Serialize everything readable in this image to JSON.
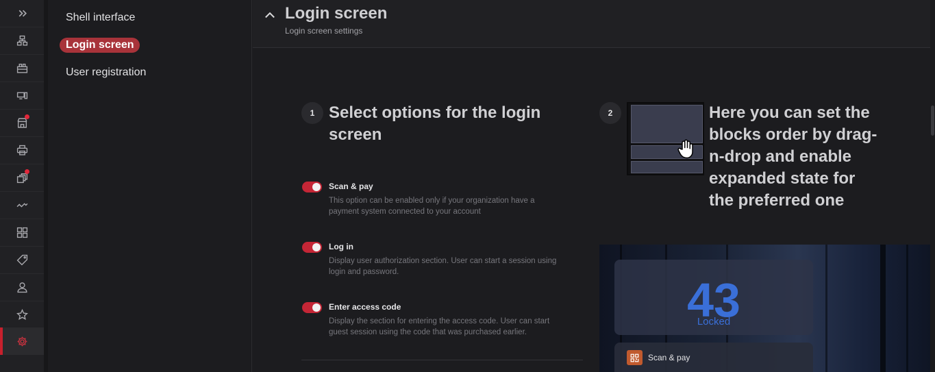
{
  "colors": {
    "accent": "#c42636",
    "active_pill": "#a8333a",
    "locked_blue": "#3a6fd8"
  },
  "rail": {
    "items": [
      {
        "icon": "expand-icon",
        "active": false,
        "notification": false
      },
      {
        "icon": "hierarchy-icon",
        "active": false,
        "notification": false
      },
      {
        "icon": "hosts-icon",
        "active": false,
        "notification": false
      },
      {
        "icon": "devices-icon",
        "active": false,
        "notification": false
      },
      {
        "icon": "store-icon",
        "active": false,
        "notification": true
      },
      {
        "icon": "printer-icon",
        "active": false,
        "notification": false
      },
      {
        "icon": "copies-icon",
        "active": false,
        "notification": true
      },
      {
        "icon": "activity-icon",
        "active": false,
        "notification": false
      },
      {
        "icon": "grid-icon",
        "active": false,
        "notification": false
      },
      {
        "icon": "tag-icon",
        "active": false,
        "notification": false
      },
      {
        "icon": "users-icon",
        "active": false,
        "notification": false
      },
      {
        "icon": "star-icon",
        "active": false,
        "notification": false
      },
      {
        "icon": "gear-icon",
        "active": true,
        "notification": false
      }
    ]
  },
  "submenu": {
    "items": [
      {
        "label": "Shell interface",
        "active": false
      },
      {
        "label": "Login screen",
        "active": true
      },
      {
        "label": "User registration",
        "active": false
      }
    ]
  },
  "header": {
    "title": "Login screen",
    "subtitle": "Login screen settings"
  },
  "step1": {
    "number": "1",
    "title_line1": "Select options for the login",
    "title_line2": "screen"
  },
  "options": [
    {
      "label": "Scan & pay",
      "enabled": true,
      "desc_line1": "This option can be enabled only if your organization have a",
      "desc_line2": "payment system connected to your account"
    },
    {
      "label": "Log in",
      "enabled": true,
      "desc_line1": "Display user authorization section. User can start a session using",
      "desc_line2": "login and password."
    },
    {
      "label": "Enter access code",
      "enabled": true,
      "desc_line1": "Display the section for entering the access code. User can start",
      "desc_line2": "guest session using the code that was purchased earlier."
    }
  ],
  "step2": {
    "number": "2",
    "lines": [
      "Here you can set the",
      "blocks order by drag-",
      "n-drop and enable",
      "expanded state for",
      "the preferred one"
    ]
  },
  "preview": {
    "number": "43",
    "status": "Locked",
    "row_label": "Scan & pay",
    "row_icon": "qr-code-icon"
  }
}
